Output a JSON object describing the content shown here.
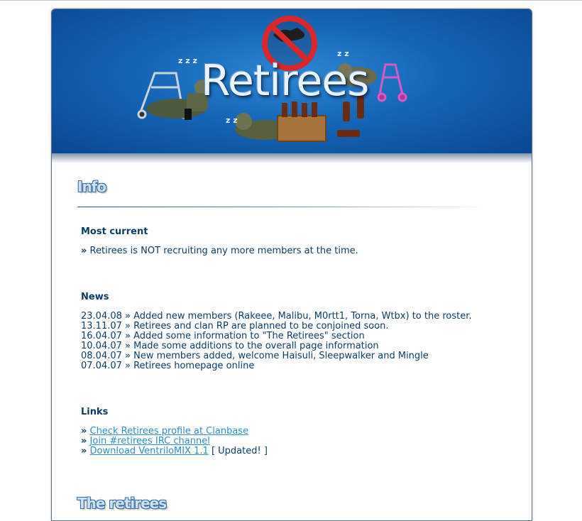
{
  "banner": {
    "logo_text": "Retirees",
    "zzz": "z z z"
  },
  "info": {
    "title": "Info",
    "most_current": {
      "heading": "Most current",
      "bullet": "»",
      "text": "Retirees is NOT recruiting any more members at the time."
    },
    "news": {
      "heading": "News",
      "items": [
        "23.04.08 » Added new members (Rakeee, Malibu, M0rtt1, Torna, Wtbx) to the roster.",
        "13.11.07 » Retirees and clan RP are planned to be conjoined soon.",
        "16.04.07 » Added some information to \"The Retirees\" section",
        "10.04.07 » Made some additions to the overall page information",
        "08.04.07 » New members added, welcome Haisuli, Sleepwalker and Mingle",
        "07.04.07 » Retirees homepage online"
      ]
    },
    "links": {
      "heading": "Links",
      "bullet": "»",
      "items": [
        {
          "label": "Check Retirees profile at Clanbase",
          "suffix": ""
        },
        {
          "label": "Join #retirees IRC channel",
          "suffix": ""
        },
        {
          "label": "Download VentriloMIX 1.1",
          "suffix": " [ Updated! ]"
        }
      ]
    }
  },
  "retirees_section": {
    "title": "The retirees"
  },
  "colors": {
    "text": "#0d3d66",
    "link": "#2d8fc7",
    "banner_dark": "#0a4790",
    "banner_light": "#2f86d6"
  }
}
